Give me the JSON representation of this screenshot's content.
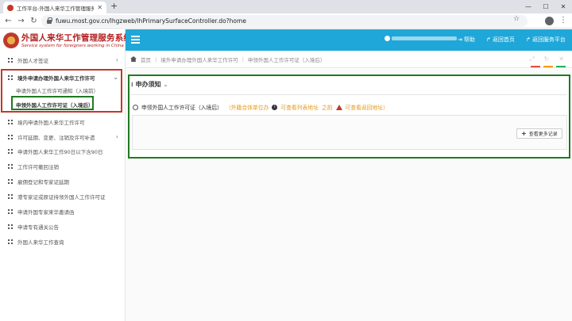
{
  "browser": {
    "tab_title": "工作平台-外国人来华工作管理服务系统",
    "url": "fuwu.most.gov.cn/lhgzweb/lhPrimarySurfaceController.do?home"
  },
  "header": {
    "logo_cn": "外国人来华工作管理服务系统",
    "logo_en": "Service system for foreigners working in China",
    "nav": {
      "help": "帮助",
      "switch": "返回首页",
      "platform": "返回服务平台"
    }
  },
  "sidebar": {
    "items": [
      {
        "label": "外国人才签证"
      },
      {
        "label": "境外申请办理外国人来华工作许可"
      },
      {
        "label": "申请外国人工作许可通知（入境前）"
      },
      {
        "label": "申领外国人工作许可证（入境后）"
      },
      {
        "label": "境内申请外国人来华工作许可"
      },
      {
        "label": "许可延期、变更、注销及许可补遗"
      },
      {
        "label": "申请外国人来华工作90日以下含90日"
      },
      {
        "label": "工作许可撤回注销"
      },
      {
        "label": "雇佣登记和专家证延期"
      },
      {
        "label": "港专家证或原证持领外国人工作许可证"
      },
      {
        "label": "申请外国专家来华邀请函"
      },
      {
        "label": "申请专有通关公告"
      },
      {
        "label": "外国人来华工作查询"
      }
    ]
  },
  "breadcrumb": {
    "home": "首页",
    "level1": "境外申请办理外国人来华工作许可",
    "level2": "申领外国人工作许可证（入境后）"
  },
  "panel": {
    "title": "申办须知",
    "form_label": "申领外国人工作许可证（入境后）",
    "status_pending": "（外籍合体单位办",
    "status_review": "可查看列表地址",
    "status_sep": "之前",
    "status_return": "可查看返回地址）",
    "more_button": "查看更多记录"
  }
}
